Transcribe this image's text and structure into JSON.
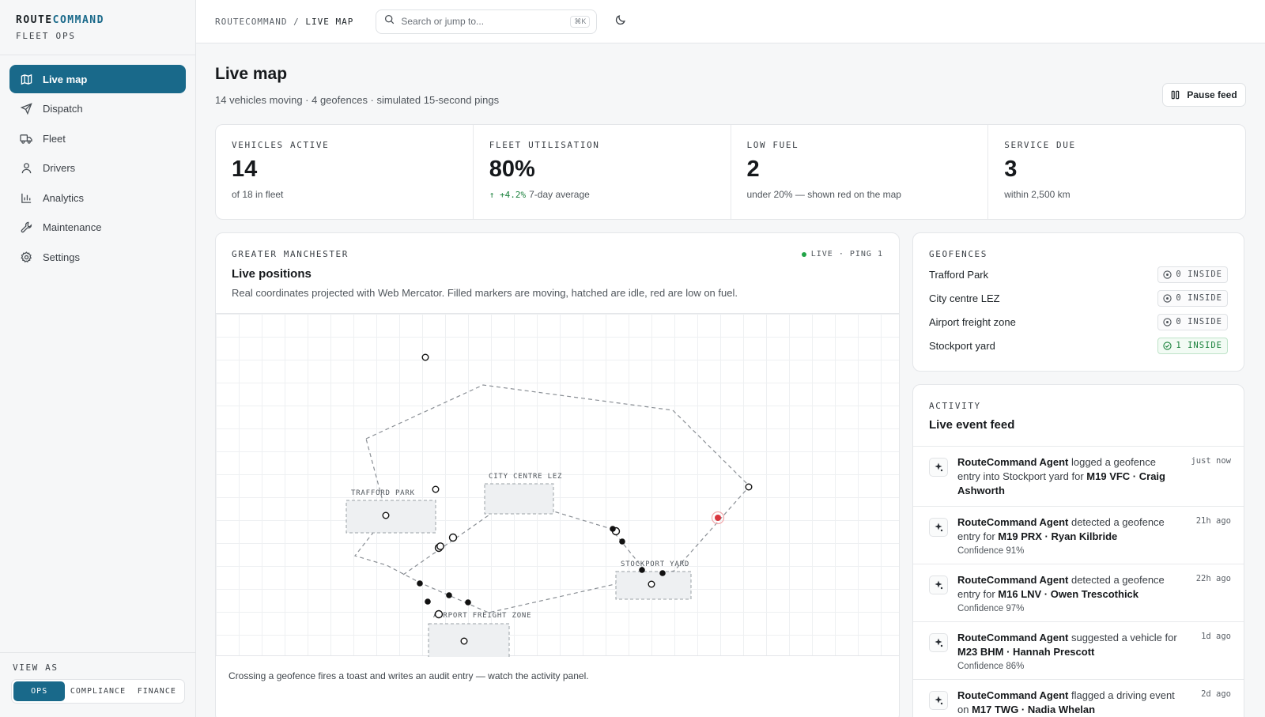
{
  "brand": {
    "name_prefix": "ROUTE",
    "name_accent": "COMMAND",
    "sub": "FLEET OPS"
  },
  "nav": [
    {
      "label": "Live map",
      "icon": "map-icon",
      "active": true
    },
    {
      "label": "Dispatch",
      "icon": "send-icon"
    },
    {
      "label": "Fleet",
      "icon": "truck-icon"
    },
    {
      "label": "Drivers",
      "icon": "user-icon"
    },
    {
      "label": "Analytics",
      "icon": "bar-chart-icon"
    },
    {
      "label": "Maintenance",
      "icon": "wrench-icon"
    },
    {
      "label": "Settings",
      "icon": "gear-icon"
    }
  ],
  "view_as": {
    "label": "VIEW AS",
    "options": [
      "OPS",
      "COMPLIANCE",
      "FINANCE"
    ],
    "selected": "OPS"
  },
  "topbar": {
    "crumb_root": "ROUTECOMMAND",
    "crumb_sep": "/",
    "crumb_current": "LIVE MAP",
    "search_placeholder": "Search or jump to...",
    "shortcut": "⌘K"
  },
  "page": {
    "title": "Live map",
    "subtitle": "14 vehicles moving · 4 geofences · simulated 15-second pings",
    "pause_label": "Pause feed"
  },
  "kpis": [
    {
      "label": "VEHICLES ACTIVE",
      "value": "14",
      "detail": "of 18 in fleet"
    },
    {
      "label": "FLEET UTILISATION",
      "value": "80%",
      "delta": "↑ +4.2%",
      "detail": "7-day average"
    },
    {
      "label": "LOW FUEL",
      "value": "2",
      "detail": "under 20% — shown red on the map"
    },
    {
      "label": "SERVICE DUE",
      "value": "3",
      "detail": "within 2,500 km"
    }
  ],
  "map": {
    "eyebrow": "GREATER MANCHESTER",
    "live_label": "LIVE · PING 1",
    "title": "Live positions",
    "description": "Real coordinates projected with Web Mercator. Filled markers are moving, hatched are idle, red are low on fuel.",
    "footer": "Crossing a geofence fires a toast and writes an audit entry — watch the activity panel.",
    "zones": [
      "TRAFFORD PARK",
      "CITY CENTRE LEZ",
      "STOCKPORT YARD",
      "AIRPORT FREIGHT ZONE"
    ],
    "colors": {
      "moving": "#111111",
      "low_fuel": "#d9363e",
      "zone_fill": "#eef0f2"
    }
  },
  "geofences": {
    "eyebrow": "GEOFENCES",
    "items": [
      {
        "name": "Trafford Park",
        "badge": "0 INSIDE",
        "inside": false
      },
      {
        "name": "City centre LEZ",
        "badge": "0 INSIDE",
        "inside": false
      },
      {
        "name": "Airport freight zone",
        "badge": "0 INSIDE",
        "inside": false
      },
      {
        "name": "Stockport yard",
        "badge": "1 INSIDE",
        "inside": true
      }
    ]
  },
  "activity": {
    "eyebrow": "ACTIVITY",
    "title": "Live event feed",
    "events": [
      {
        "actor": "RouteCommand Agent",
        "action": " logged a geofence entry into Stockport yard for ",
        "subject": "M19 VFC · Craig Ashworth",
        "confidence": "",
        "time": "just now"
      },
      {
        "actor": "RouteCommand Agent",
        "action": " detected a geofence entry for ",
        "subject": "M19 PRX · Ryan Kilbride",
        "confidence": "Confidence 91%",
        "time": "21h ago"
      },
      {
        "actor": "RouteCommand Agent",
        "action": " detected a geofence entry for ",
        "subject": "M16 LNV · Owen Trescothick",
        "confidence": "Confidence 97%",
        "time": "22h ago"
      },
      {
        "actor": "RouteCommand Agent",
        "action": " suggested a vehicle for ",
        "subject": "M23 BHM · Hannah Prescott",
        "confidence": "Confidence 86%",
        "time": "1d ago"
      },
      {
        "actor": "RouteCommand Agent",
        "action": " flagged a driving event on ",
        "subject": "M17 TWG · Nadia Whelan",
        "confidence": "",
        "time": "2d ago"
      }
    ]
  }
}
